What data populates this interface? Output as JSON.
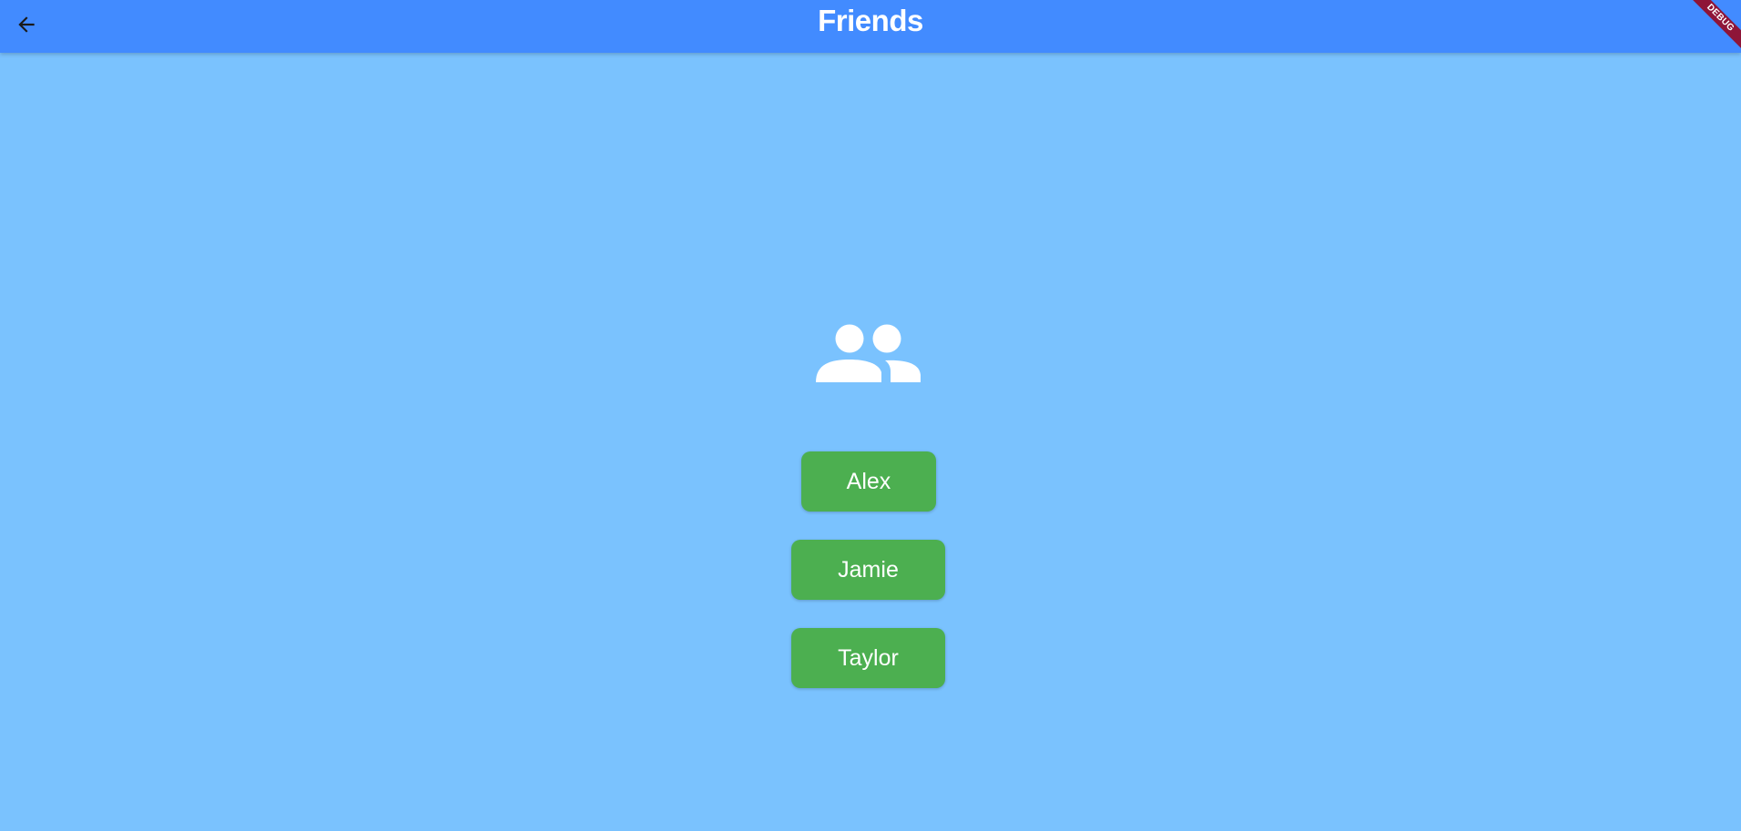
{
  "appbar": {
    "title": "Friends",
    "back_icon": "arrow-back-icon",
    "color": "#428BFF"
  },
  "debug_banner": {
    "label": "DEBUG",
    "color": "#8E1538"
  },
  "main": {
    "background": "#7AC2FE",
    "icon": "people-icon",
    "friends": [
      {
        "label": "Alex"
      },
      {
        "label": "Jamie"
      },
      {
        "label": "Taylor"
      }
    ],
    "button_color": "#4CAF50"
  }
}
